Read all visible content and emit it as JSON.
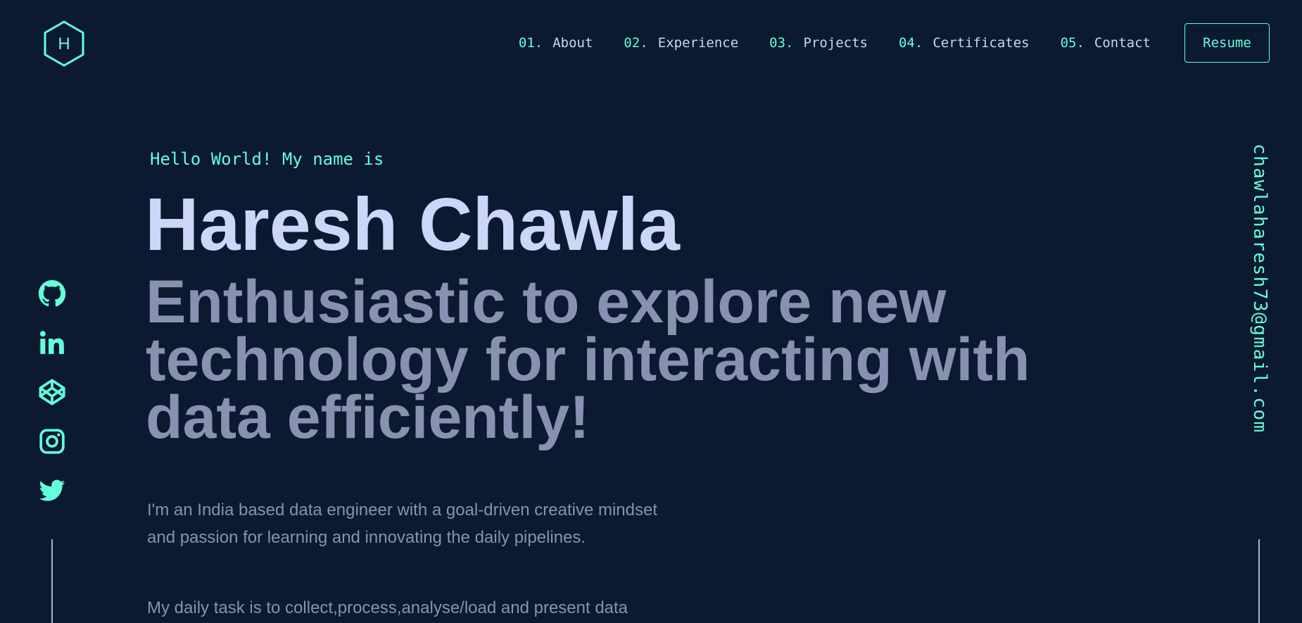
{
  "header": {
    "logo_letter": "H",
    "nav": [
      {
        "num": "01.",
        "label": "About"
      },
      {
        "num": "02.",
        "label": "Experience"
      },
      {
        "num": "03.",
        "label": "Projects"
      },
      {
        "num": "04.",
        "label": "Certificates"
      },
      {
        "num": "05.",
        "label": "Contact"
      }
    ],
    "resume_label": "Resume"
  },
  "hero": {
    "greeting": "Hello World! My name is",
    "name": "Haresh Chawla",
    "tagline": "Enthusiastic to explore new technology for interacting with data efficiently!",
    "intro": "I'm an India based data engineer with a goal-driven creative mindset and passion for learning and innovating the daily pipelines.",
    "intro2": "My daily task is to collect,process,analyse/load and present data"
  },
  "social": {
    "icons": [
      "github-icon",
      "linkedin-icon",
      "codepen-icon",
      "instagram-icon",
      "twitter-icon"
    ]
  },
  "email": "chawlaharesh73@gmail.com",
  "colors": {
    "background": "#0b1931",
    "accent": "#64ffda",
    "heading": "#ccd6f6",
    "muted": "#8892b0"
  }
}
